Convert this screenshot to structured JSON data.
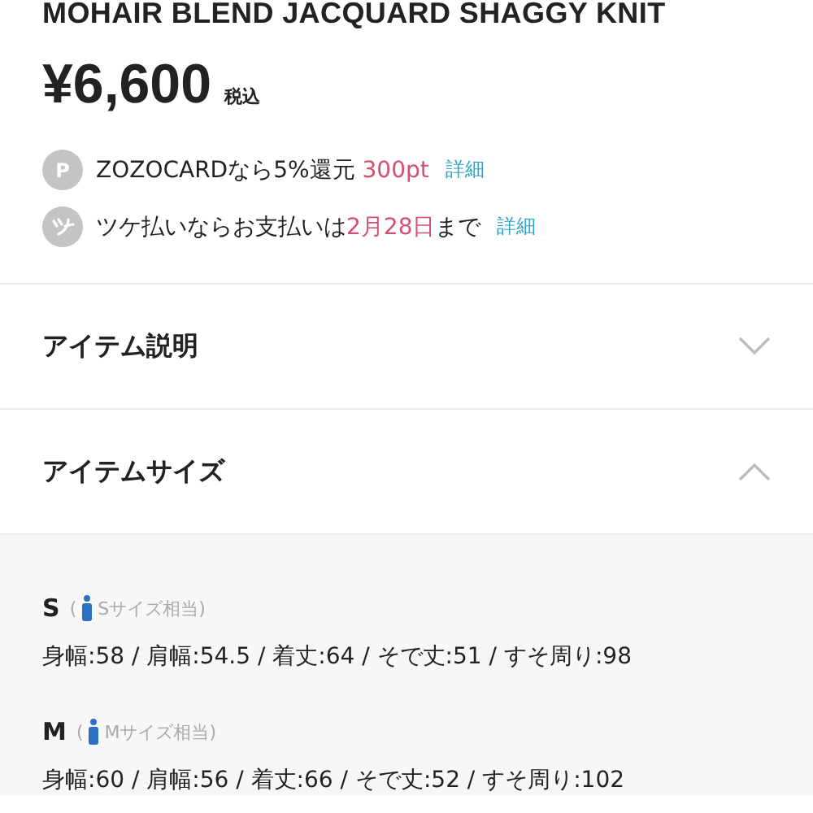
{
  "product": {
    "title": "MOHAIR BLEND JACQUARD SHAGGY KNIT",
    "price": "¥6,600",
    "tax_note": "税込"
  },
  "benefits": [
    {
      "kind": "point",
      "icon_text": "P",
      "parts": [
        {
          "text": "ZOZOCARDなら5%還元 ",
          "highlight": false
        },
        {
          "text": "300pt",
          "highlight": true
        }
      ],
      "link": "詳細"
    },
    {
      "kind": "tsuke",
      "parts": [
        {
          "text": "ツケ払いならお支払いは",
          "highlight": false
        },
        {
          "text": "2月28日",
          "highlight": true
        },
        {
          "text": "まで",
          "highlight": false
        }
      ],
      "link": "詳細"
    }
  ],
  "sections": [
    {
      "title": "アイテム説明",
      "expanded": false
    },
    {
      "title": "アイテムサイズ",
      "expanded": true
    }
  ],
  "sizes": [
    {
      "label": "S",
      "note_open": "(",
      "note": "Sサイズ相当)",
      "measurements": "身幅:58 / 肩幅:54.5 / 着丈:64 / そで丈:51 / すそ周り:98"
    },
    {
      "label": "M",
      "note_open": "(",
      "note": "Mサイズ相当)",
      "measurements": "身幅:60 / 肩幅:56 / 着丈:66 / そで丈:52 / すそ周り:102"
    }
  ]
}
